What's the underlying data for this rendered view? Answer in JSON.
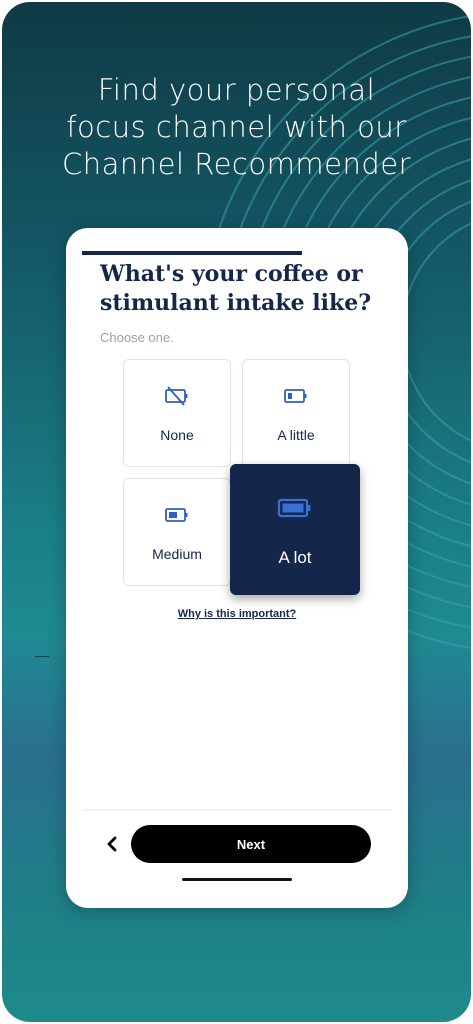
{
  "hero": {
    "headline_lines": [
      "Find your personal",
      "focus channel with our",
      "Channel Recommender"
    ]
  },
  "quiz": {
    "progress_fraction": 0.71,
    "question_lines": [
      "What's your coffee or",
      "stimulant intake like?"
    ],
    "helper": "Choose one.",
    "options": [
      {
        "label": "None",
        "icon": "battery-empty-slashed-icon",
        "selected": false
      },
      {
        "label": "A little",
        "icon": "battery-low-icon",
        "selected": false
      },
      {
        "label": "Medium",
        "icon": "battery-medium-icon",
        "selected": false
      },
      {
        "label": "A lot",
        "icon": "battery-full-icon",
        "selected": true
      }
    ],
    "why_link": "Why is this important?",
    "back_icon": "chevron-left-icon",
    "next_label": "Next"
  },
  "colors": {
    "navy": "#14264a",
    "icon_blue": "#2d5fc4",
    "selected_icon": "#3b6fd8",
    "teal_bg": "#1a7c86"
  }
}
